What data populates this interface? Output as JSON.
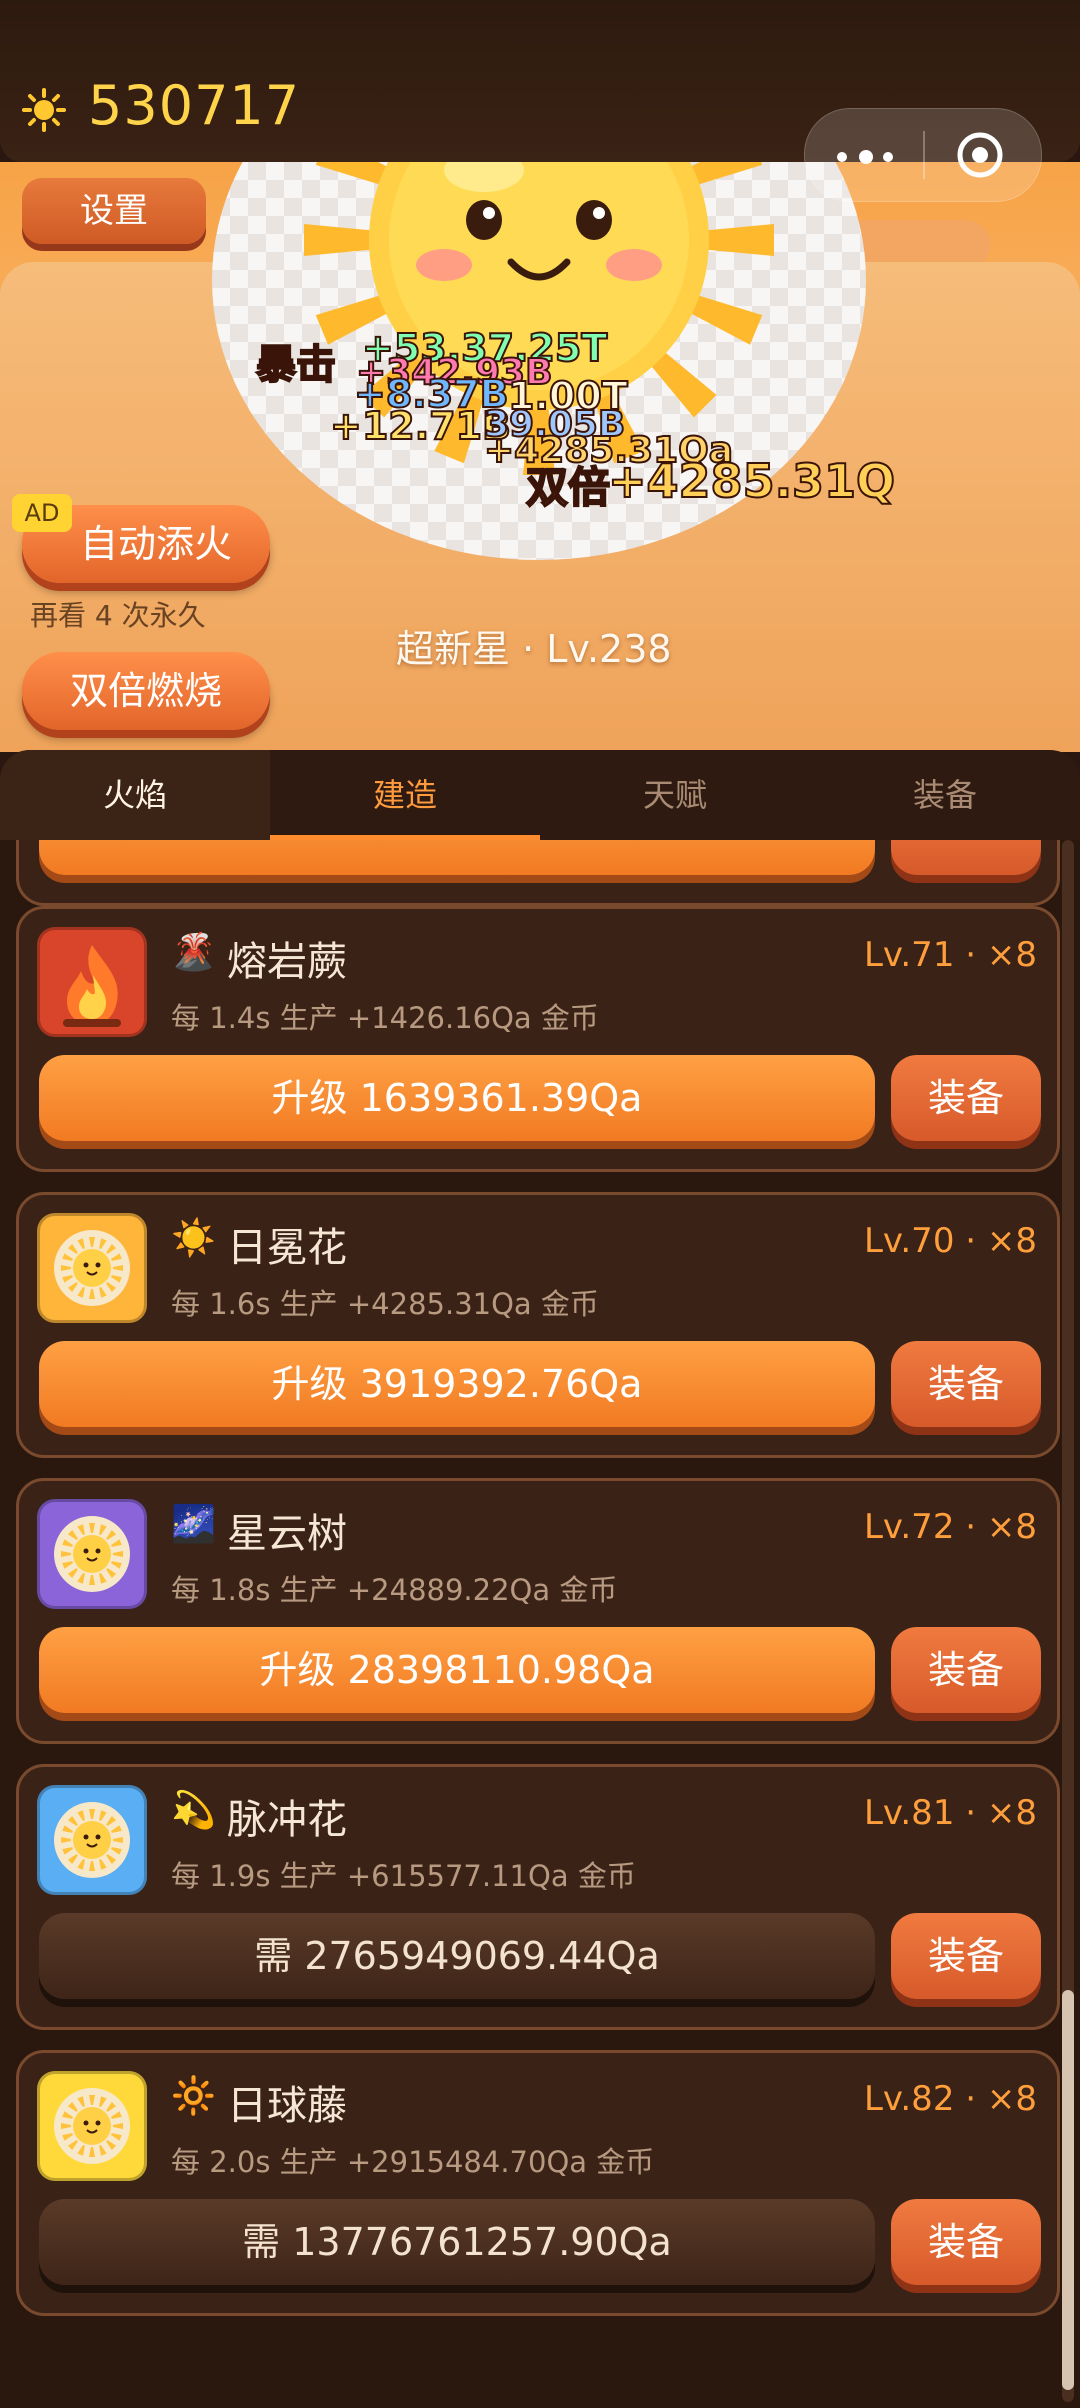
{
  "header": {
    "coins": "530717",
    "settings_label": "设置"
  },
  "hero": {
    "ad_label": "AD",
    "auto_fire_label": "自动添火",
    "watch_hint": "再看 4 次永久",
    "double_burn_label": "双倍燃烧",
    "level_text": "超新星 · Lv.238",
    "floating_texts": [
      {
        "text": "暴击",
        "color": "#ff6a3a"
      },
      {
        "text": "+53.37.25T",
        "color": "#7fffb0"
      },
      {
        "text": "+342.93B",
        "color": "#ff7ab0"
      },
      {
        "text": "+8.37B",
        "color": "#6fb8ff"
      },
      {
        "text": "1.00T",
        "color": "#fff7d8"
      },
      {
        "text": "+12.71B",
        "color": "#ffe06a"
      },
      {
        "text": "39.05B",
        "color": "#9fc7ff"
      },
      {
        "text": "+4285.31Qa",
        "color": "#ffd36a"
      },
      {
        "text": "双倍",
        "color": "#ffe9b0"
      },
      {
        "text": "+4285.31Q",
        "color": "#ffcf58"
      }
    ]
  },
  "tabs": [
    {
      "label": "火焰"
    },
    {
      "label": "建造"
    },
    {
      "label": "天赋"
    },
    {
      "label": "装备"
    }
  ],
  "buildings": [
    {
      "emoji": "🌋",
      "name": "熔岩蕨",
      "level": "Lv.71 · ×8",
      "rate": "每 1.4s 生产 +1426.16Qa 金币",
      "action": "升级 1639361.39Qa",
      "equip": "装备",
      "icon_bg": "#d9452a",
      "icon": "flame-icon",
      "locked": false
    },
    {
      "emoji": "☀️",
      "name": "日冕花",
      "level": "Lv.70 · ×8",
      "rate": "每 1.6s 生产 +4285.31Qa 金币",
      "action": "升级 3919392.76Qa",
      "equip": "装备",
      "icon_bg": "#ffb43a",
      "icon": "sun-icon",
      "locked": false
    },
    {
      "emoji": "🌌",
      "name": "星云树",
      "level": "Lv.72 · ×8",
      "rate": "每 1.8s 生产 +24889.22Qa 金币",
      "action": "升级 28398110.98Qa",
      "equip": "装备",
      "icon_bg": "#8a64d8",
      "icon": "sun-icon",
      "locked": false
    },
    {
      "emoji": "💫",
      "name": "脉冲花",
      "level": "Lv.81 · ×8",
      "rate": "每 1.9s 生产 +615577.11Qa 金币",
      "action": "需 2765949069.44Qa",
      "equip": "装备",
      "icon_bg": "#5aaef4",
      "icon": "sun-icon",
      "locked": true
    },
    {
      "emoji": "🔆",
      "name": "日球藤",
      "level": "Lv.82 · ×8",
      "rate": "每 2.0s 生产 +2915484.70Qa 金币",
      "action": "需 13776761257.90Qa",
      "equip": "装备",
      "icon_bg": "#ffd83a",
      "icon": "sun-icon",
      "locked": true
    }
  ]
}
